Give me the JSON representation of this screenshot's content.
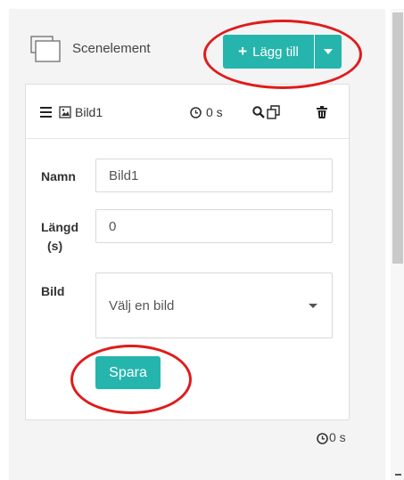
{
  "header": {
    "title": "Scenelement",
    "add_button_label": "Lägg till",
    "icons": {
      "scene": "layers-icon",
      "add": "plus-icon",
      "caret": "chevron-down-icon"
    }
  },
  "card": {
    "element_name": "Bild1",
    "duration": "0 s",
    "icons": [
      "hamburger-icon",
      "image-icon",
      "clock-icon",
      "search-icon",
      "copy-icon",
      "trash-icon"
    ]
  },
  "form": {
    "name_label": "Namn",
    "name_value": "Bild1",
    "length_label_line1": "Längd",
    "length_label_line2": "(s)",
    "length_value": "0",
    "image_label": "Bild",
    "image_placeholder": "Välj en bild",
    "save_label": "Spara"
  },
  "footer": {
    "total_duration": "0 s"
  },
  "colors": {
    "accent": "#26b5ad",
    "highlight": "#e01b1b"
  }
}
